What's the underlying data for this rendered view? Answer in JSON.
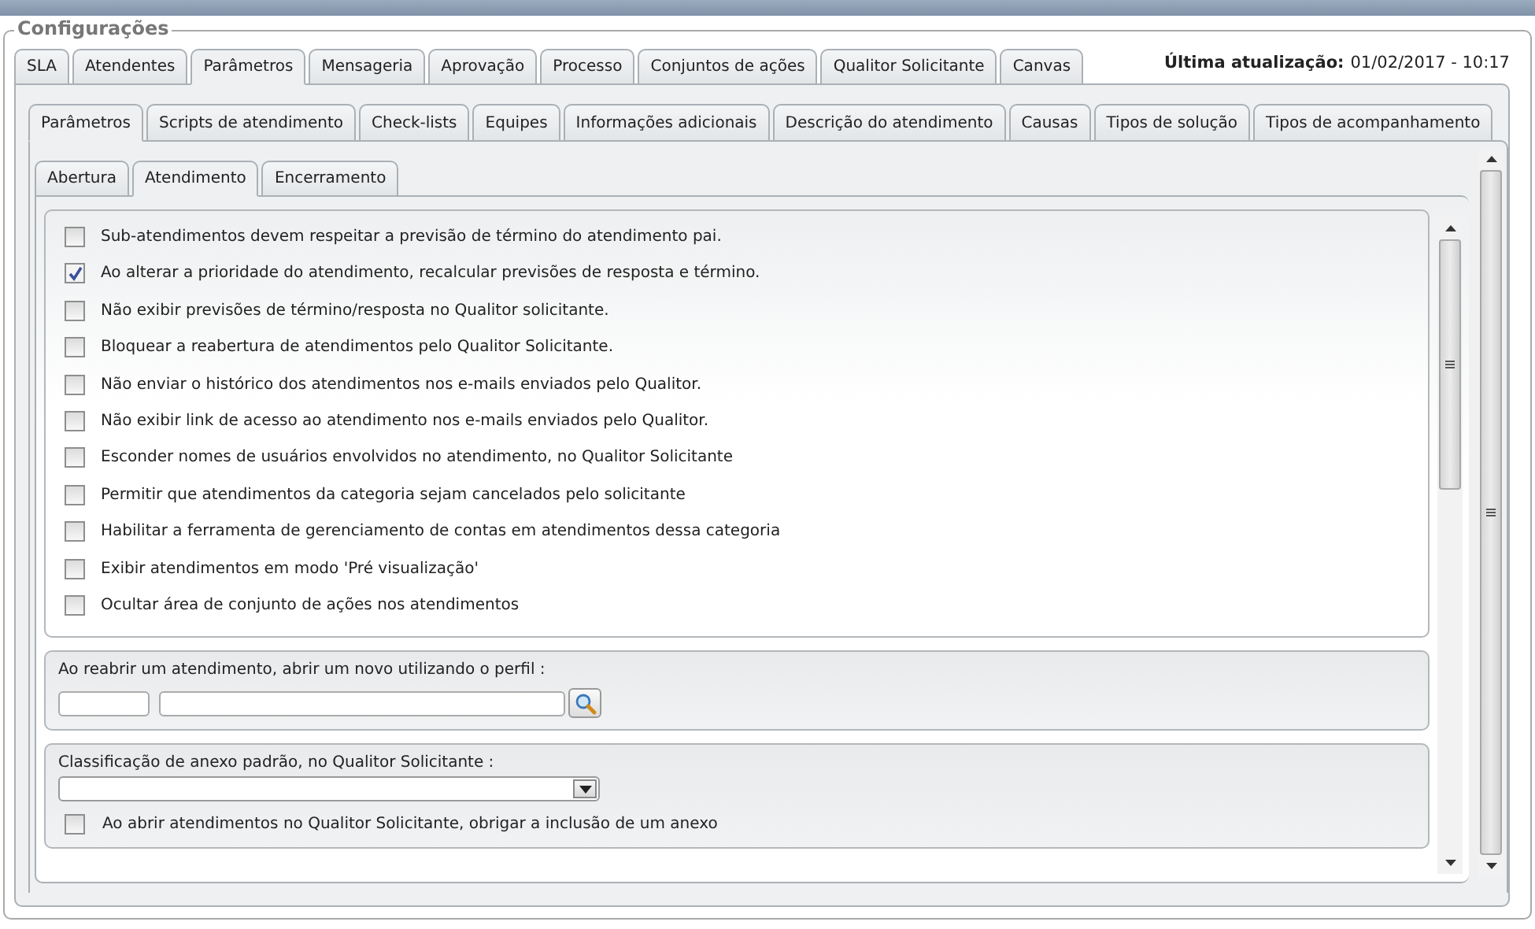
{
  "window_header": {
    "title": "Configurações",
    "last_update_label": "Última atualização:",
    "last_update_value": "01/02/2017 - 10:17"
  },
  "main_tabs": [
    {
      "label": "SLA",
      "selected": false
    },
    {
      "label": "Atendentes",
      "selected": false
    },
    {
      "label": "Parâmetros",
      "selected": true
    },
    {
      "label": "Mensageria",
      "selected": false
    },
    {
      "label": "Aprovação",
      "selected": false
    },
    {
      "label": "Processo",
      "selected": false
    },
    {
      "label": "Conjuntos de ações",
      "selected": false
    },
    {
      "label": "Qualitor Solicitante",
      "selected": false
    },
    {
      "label": "Canvas",
      "selected": false
    }
  ],
  "sub_tabs": [
    {
      "label": "Parâmetros",
      "selected": true
    },
    {
      "label": "Scripts de atendimento",
      "selected": false
    },
    {
      "label": "Check-lists",
      "selected": false
    },
    {
      "label": "Equipes",
      "selected": false
    },
    {
      "label": "Informações adicionais",
      "selected": false
    },
    {
      "label": "Descrição do atendimento",
      "selected": false
    },
    {
      "label": "Causas",
      "selected": false
    },
    {
      "label": "Tipos de solução",
      "selected": false
    },
    {
      "label": "Tipos de acompanhamento",
      "selected": false
    }
  ],
  "section_tabs": [
    {
      "label": "Abertura",
      "selected": false
    },
    {
      "label": "Atendimento",
      "selected": true
    },
    {
      "label": "Encerramento",
      "selected": false
    }
  ],
  "options": [
    {
      "label": "Sub-atendimentos devem respeitar a previsão de término do atendimento pai.",
      "checked": false
    },
    {
      "label": "Ao alterar a prioridade do atendimento, recalcular previsões de resposta e término.",
      "checked": true
    },
    {
      "label": "Não exibir previsões de término/resposta no Qualitor solicitante.",
      "checked": false
    },
    {
      "label": "Bloquear a reabertura de atendimentos pelo Qualitor Solicitante.",
      "checked": false
    },
    {
      "label": "Não enviar o histórico dos atendimentos nos e-mails enviados pelo Qualitor.",
      "checked": false
    },
    {
      "label": "Não exibir link de acesso ao atendimento nos e-mails enviados pelo Qualitor.",
      "checked": false
    },
    {
      "label": "Esconder nomes de usuários envolvidos no atendimento, no Qualitor Solicitante",
      "checked": false
    },
    {
      "label": "Permitir que atendimentos da categoria sejam cancelados pelo solicitante",
      "checked": false
    },
    {
      "label": "Habilitar a ferramenta de gerenciamento de contas em atendimentos dessa categoria",
      "checked": false
    },
    {
      "label": "Exibir atendimentos em modo 'Pré visualização'",
      "checked": false
    },
    {
      "label": "Ocultar área de conjunto de ações nos atendimentos",
      "checked": false
    }
  ],
  "reopen_profile": {
    "label": "Ao reabrir um atendimento, abrir um novo utilizando o perfil :"
  },
  "attachment": {
    "label": "Classificação de anexo padrão, no Qualitor Solicitante :",
    "require_option": {
      "label": "Ao abrir atendimentos no Qualitor Solicitante, obrigar a inclusão de um anexo",
      "checked": false
    }
  }
}
